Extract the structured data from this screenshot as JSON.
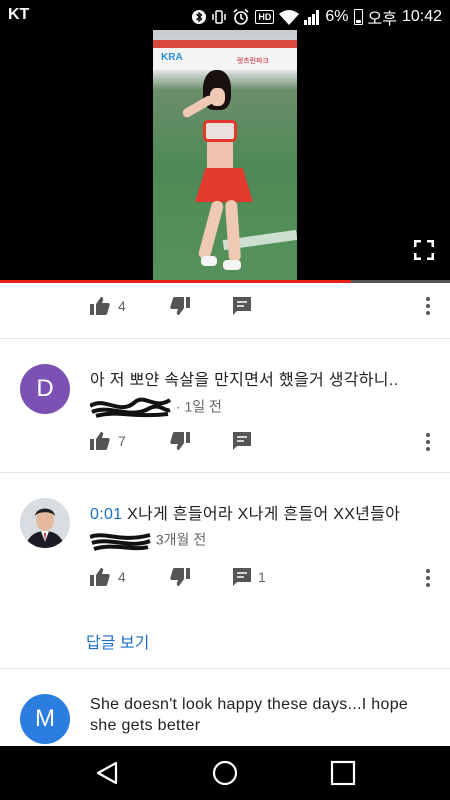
{
  "status_bar": {
    "carrier": "KT",
    "battery_percent": "6%",
    "ampm": "오후",
    "time": "10:42",
    "hd_label": "HD",
    "icons": [
      "bluetooth-icon",
      "vibrate-icon",
      "alarm-icon",
      "hd-icon",
      "wifi-icon",
      "signal-icon",
      "battery-icon"
    ]
  },
  "video": {
    "banner_logo": "KRA",
    "banner_sub": "렛츠런파크",
    "progress": 0.78,
    "accent": "#e62117"
  },
  "comments": [
    {
      "avatar_letter": null,
      "text": null,
      "time_ago": null,
      "likes": "4",
      "replies": ""
    },
    {
      "avatar_letter": "D",
      "avatar_color": "#7b52b4",
      "text": "아 저 뽀얀 속살을 만지면서 했을거 생각하니..",
      "time_ago": "1일 전",
      "likes": "7",
      "replies": ""
    },
    {
      "avatar_letter": "",
      "timestamp": "0:01",
      "text": "X나게 흔들어라 X나게 흔들어 XX년들아",
      "time_ago": "3개월 전",
      "likes": "4",
      "replies": "1"
    },
    {
      "avatar_letter": "M",
      "avatar_color": "#2b7de0",
      "text_line1": "She doesn't look happy these days...I hope",
      "text_line2": "she gets better"
    }
  ],
  "view_replies_label": "답글 보기",
  "nav": {
    "icons": [
      "back-icon",
      "home-icon",
      "recents-icon"
    ]
  }
}
